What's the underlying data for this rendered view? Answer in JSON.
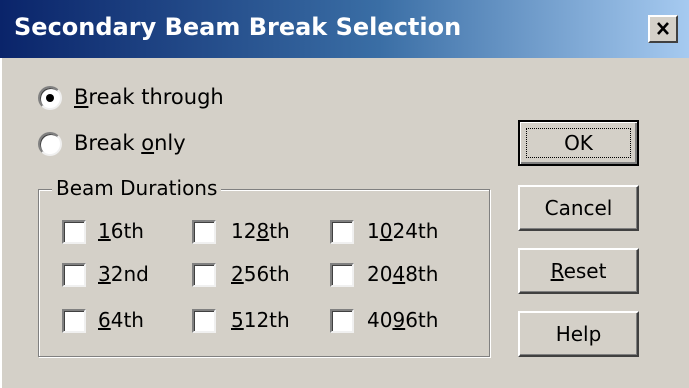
{
  "window": {
    "title": "Secondary Beam Break Selection",
    "close_icon": "close-x-icon"
  },
  "options": {
    "break_through": {
      "label_accel": "B",
      "label_rest": "reak through",
      "selected": true
    },
    "break_only": {
      "label_pre": "Break ",
      "label_accel": "o",
      "label_rest": "nly",
      "selected": false
    }
  },
  "beam_durations": {
    "title": "Beam Durations",
    "items": [
      {
        "pre": "",
        "accel": "1",
        "rest": "6th",
        "checked": false
      },
      {
        "pre": "",
        "accel": "3",
        "rest": "2nd",
        "checked": false
      },
      {
        "pre": "",
        "accel": "6",
        "rest": "4th",
        "checked": false
      },
      {
        "pre": "12",
        "accel": "8",
        "rest": "th",
        "checked": false
      },
      {
        "pre": "",
        "accel": "2",
        "rest": "56th",
        "checked": false
      },
      {
        "pre": "",
        "accel": "5",
        "rest": "12th",
        "checked": false
      },
      {
        "pre": "1",
        "accel": "0",
        "rest": "24th",
        "checked": false
      },
      {
        "pre": "20",
        "accel": "4",
        "rest": "8th",
        "checked": false
      },
      {
        "pre": "40",
        "accel": "9",
        "rest": "6th",
        "checked": false
      }
    ]
  },
  "buttons": {
    "ok": "OK",
    "cancel": "Cancel",
    "reset_accel": "R",
    "reset_rest": "eset",
    "help": "Help"
  }
}
